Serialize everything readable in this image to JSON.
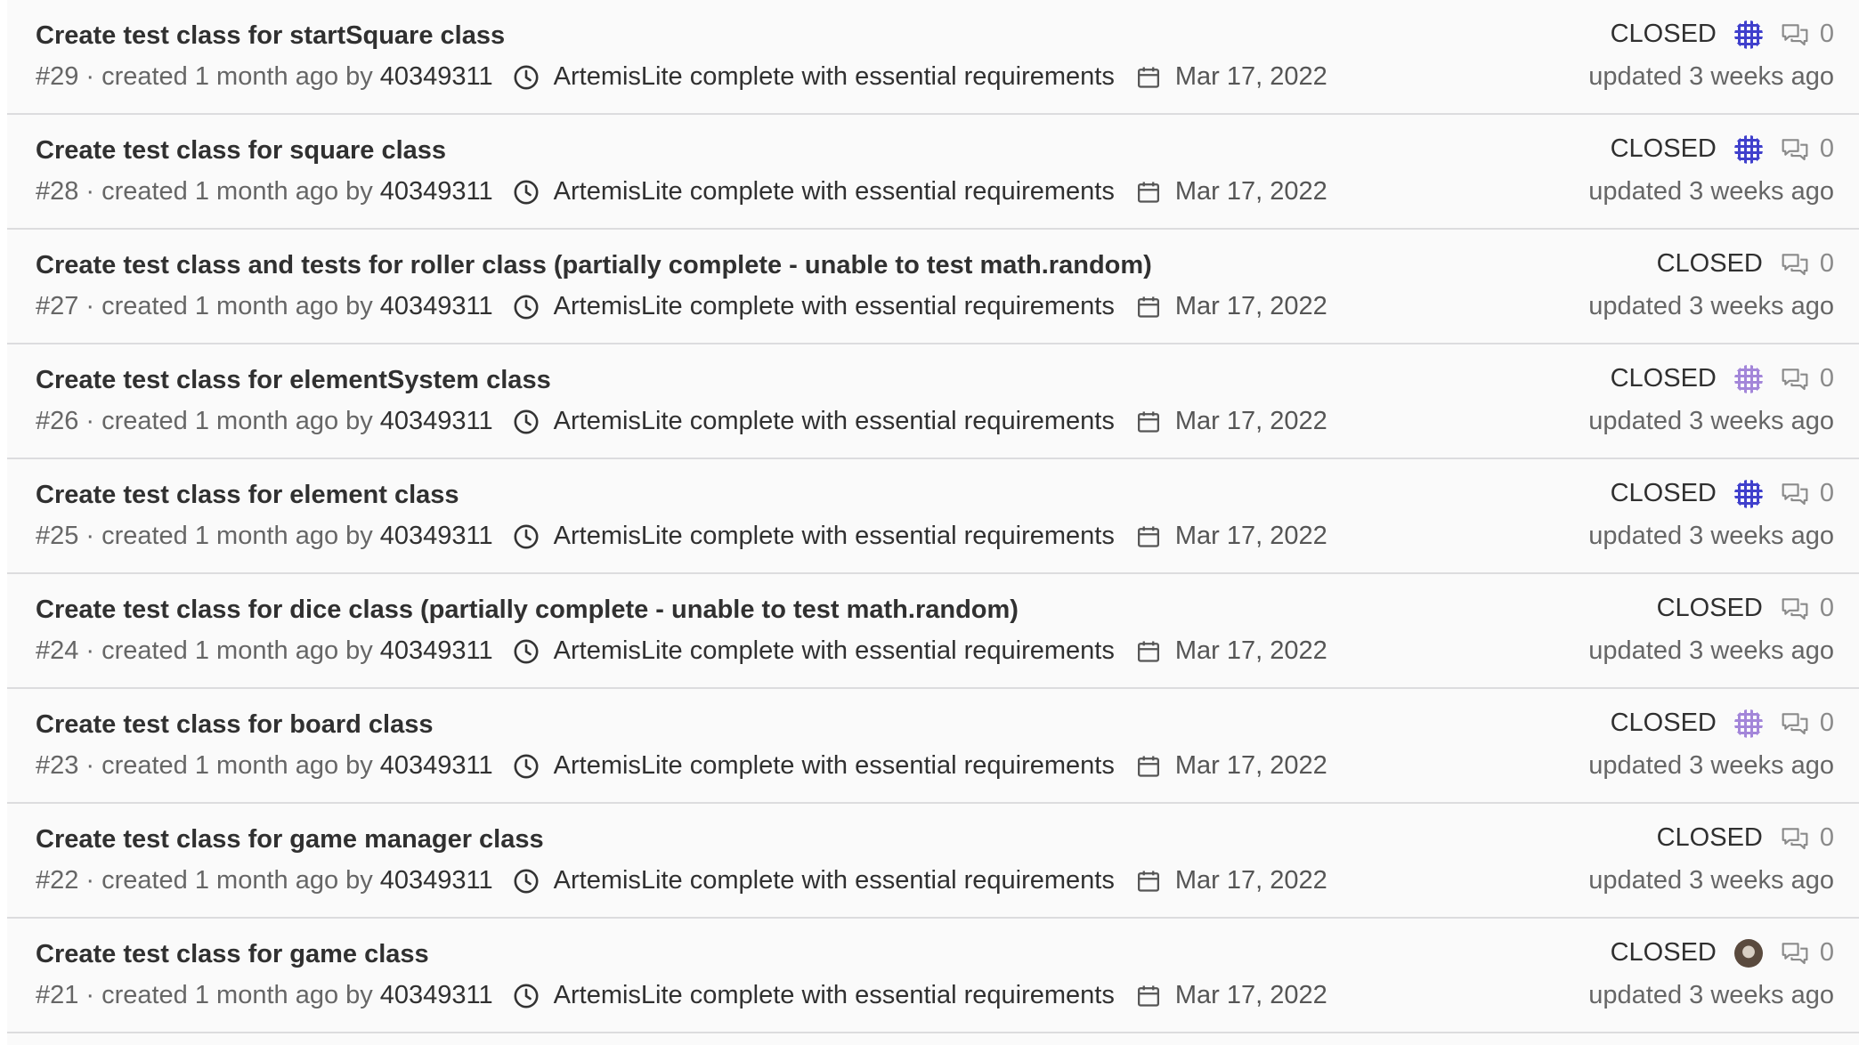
{
  "issues": [
    {
      "title": "Create test class for startSquare class",
      "iid": "#29",
      "created": "created 1 month ago by",
      "author": "40349311",
      "milestone": "ArtemisLite complete with essential requirements",
      "due": "Mar 17, 2022",
      "state": "CLOSED",
      "assignee": "identicon-blue",
      "comments": "0",
      "updated": "updated 3 weeks ago"
    },
    {
      "title": "Create test class for square class",
      "iid": "#28",
      "created": "created 1 month ago by",
      "author": "40349311",
      "milestone": "ArtemisLite complete with essential requirements",
      "due": "Mar 17, 2022",
      "state": "CLOSED",
      "assignee": "identicon-blue",
      "comments": "0",
      "updated": "updated 3 weeks ago"
    },
    {
      "title": "Create test class and tests for roller class (partially complete - unable to test math.random)",
      "iid": "#27",
      "created": "created 1 month ago by",
      "author": "40349311",
      "milestone": "ArtemisLite complete with essential requirements",
      "due": "Mar 17, 2022",
      "state": "CLOSED",
      "assignee": "",
      "comments": "0",
      "updated": "updated 3 weeks ago"
    },
    {
      "title": "Create test class for elementSystem class",
      "iid": "#26",
      "created": "created 1 month ago by",
      "author": "40349311",
      "milestone": "ArtemisLite complete with essential requirements",
      "due": "Mar 17, 2022",
      "state": "CLOSED",
      "assignee": "identicon-purple",
      "comments": "0",
      "updated": "updated 3 weeks ago"
    },
    {
      "title": "Create test class for element class",
      "iid": "#25",
      "created": "created 1 month ago by",
      "author": "40349311",
      "milestone": "ArtemisLite complete with essential requirements",
      "due": "Mar 17, 2022",
      "state": "CLOSED",
      "assignee": "identicon-blue",
      "comments": "0",
      "updated": "updated 3 weeks ago"
    },
    {
      "title": "Create test class for dice class (partially complete - unable to test math.random)",
      "iid": "#24",
      "created": "created 1 month ago by",
      "author": "40349311",
      "milestone": "ArtemisLite complete with essential requirements",
      "due": "Mar 17, 2022",
      "state": "CLOSED",
      "assignee": "",
      "comments": "0",
      "updated": "updated 3 weeks ago"
    },
    {
      "title": "Create test class for board class",
      "iid": "#23",
      "created": "created 1 month ago by",
      "author": "40349311",
      "milestone": "ArtemisLite complete with essential requirements",
      "due": "Mar 17, 2022",
      "state": "CLOSED",
      "assignee": "identicon-purple",
      "comments": "0",
      "updated": "updated 3 weeks ago"
    },
    {
      "title": "Create test class for game manager class",
      "iid": "#22",
      "created": "created 1 month ago by",
      "author": "40349311",
      "milestone": "ArtemisLite complete with essential requirements",
      "due": "Mar 17, 2022",
      "state": "CLOSED",
      "assignee": "",
      "comments": "0",
      "updated": "updated 3 weeks ago"
    },
    {
      "title": "Create test class for game class",
      "iid": "#21",
      "created": "created 1 month ago by",
      "author": "40349311",
      "milestone": "ArtemisLite complete with essential requirements",
      "due": "Mar 17, 2022",
      "state": "CLOSED",
      "assignee": "photo",
      "comments": "0",
      "updated": "updated 3 weeks ago"
    }
  ],
  "colors": {
    "identicon-blue": "#2c2cc8",
    "identicon-purple": "#9a7ad6",
    "photo": "#5a4a3e"
  }
}
